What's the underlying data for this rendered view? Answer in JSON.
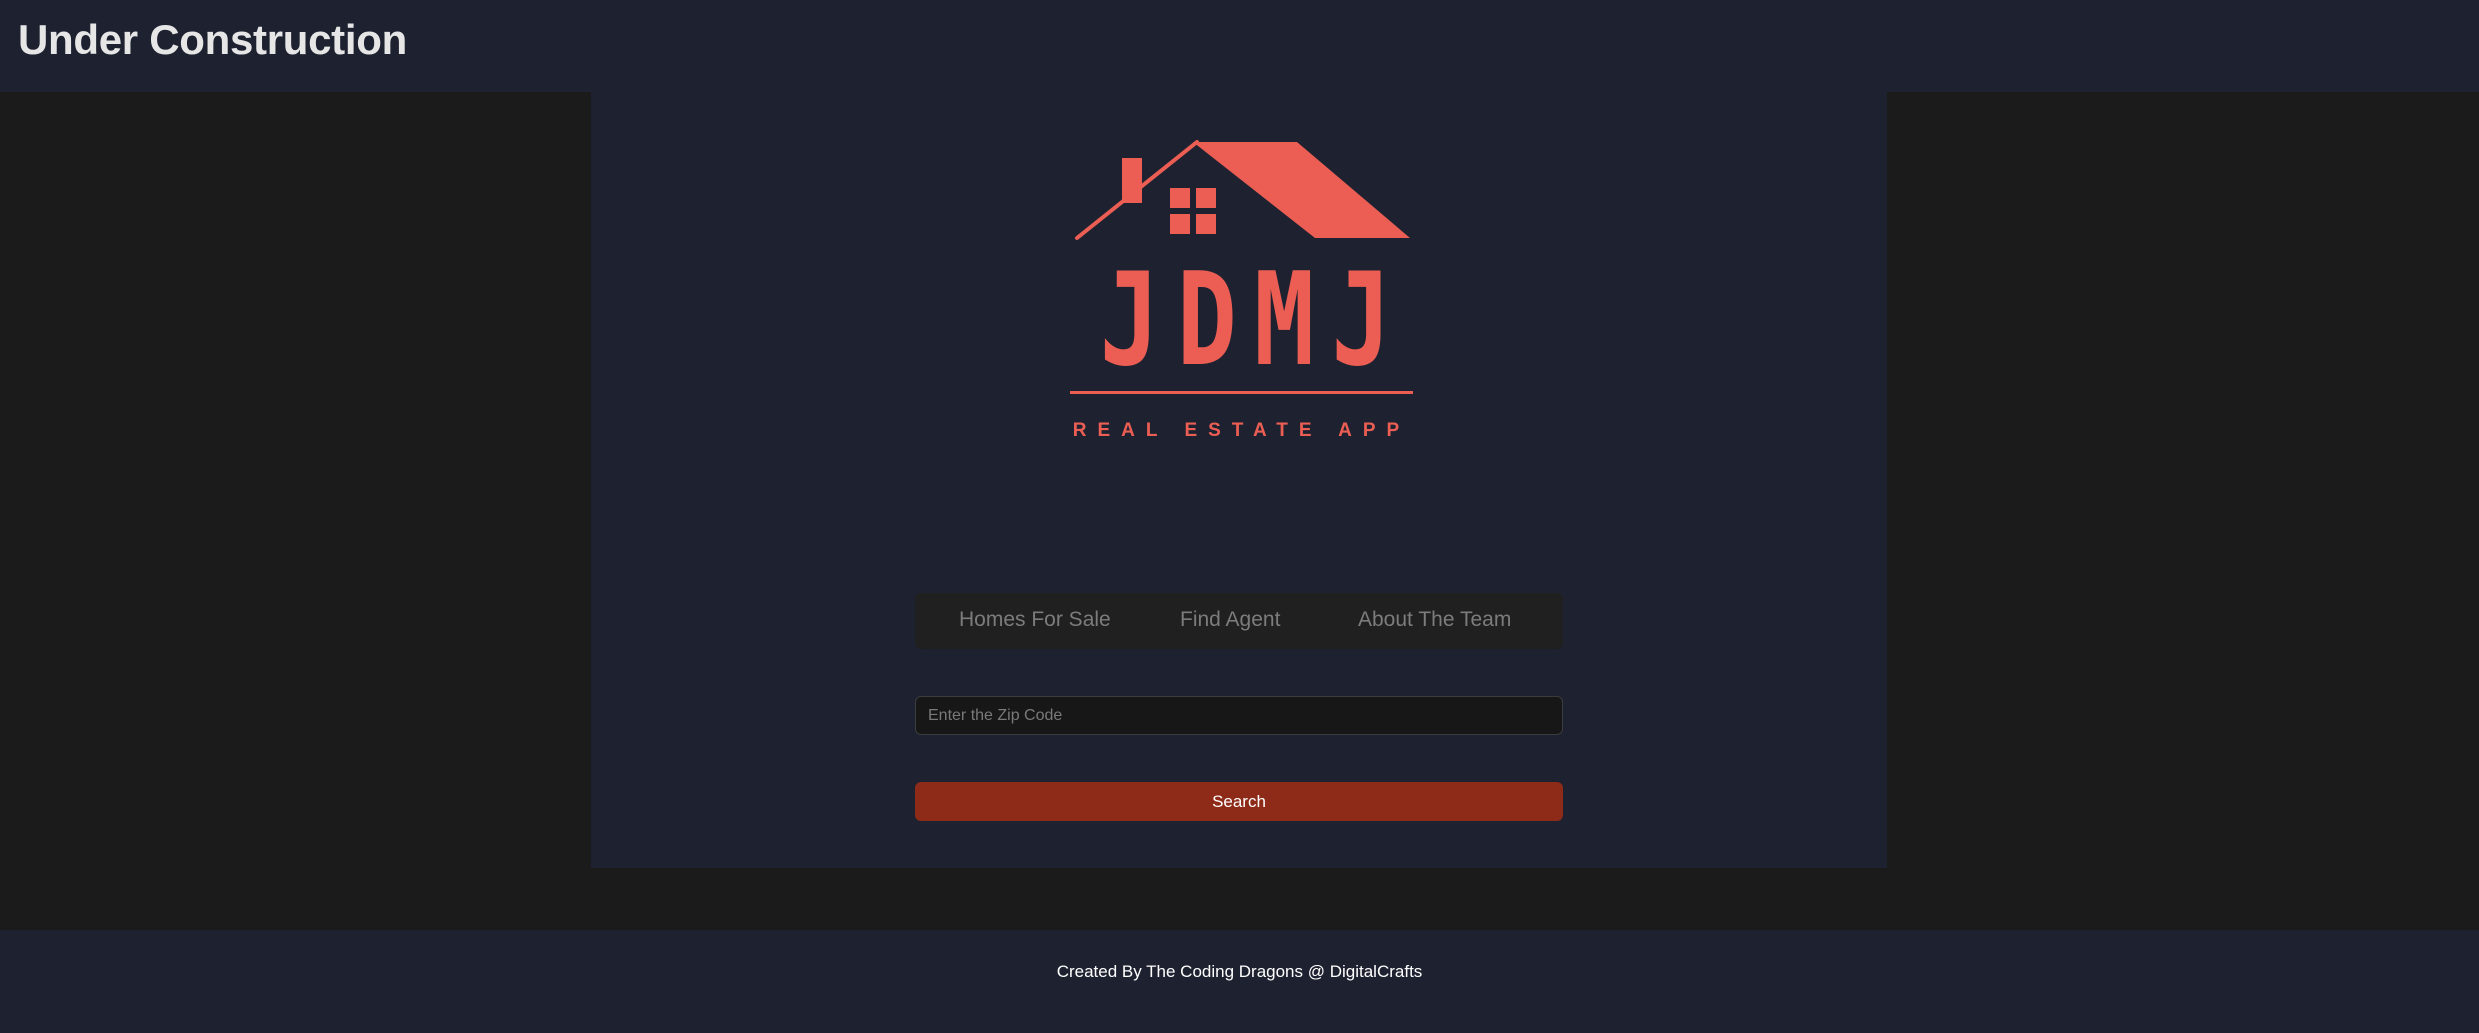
{
  "header": {
    "title": "Under Construction"
  },
  "logo": {
    "brand": "JDMJ",
    "tagline": "REAL ESTATE APP",
    "color": "#ec5e53"
  },
  "nav": {
    "items": [
      {
        "label": "Homes For Sale"
      },
      {
        "label": "Find Agent"
      },
      {
        "label": "About The Team"
      }
    ]
  },
  "search": {
    "placeholder": "Enter the Zip Code",
    "value": "",
    "button_label": "Search"
  },
  "footer": {
    "text": "Created By The Coding Dragons @ DigitalCrafts"
  },
  "colors": {
    "header_bg": "#1e2230",
    "page_bg": "#1a1b1a",
    "accent": "#ec5e53",
    "button": "#8e2a18"
  }
}
